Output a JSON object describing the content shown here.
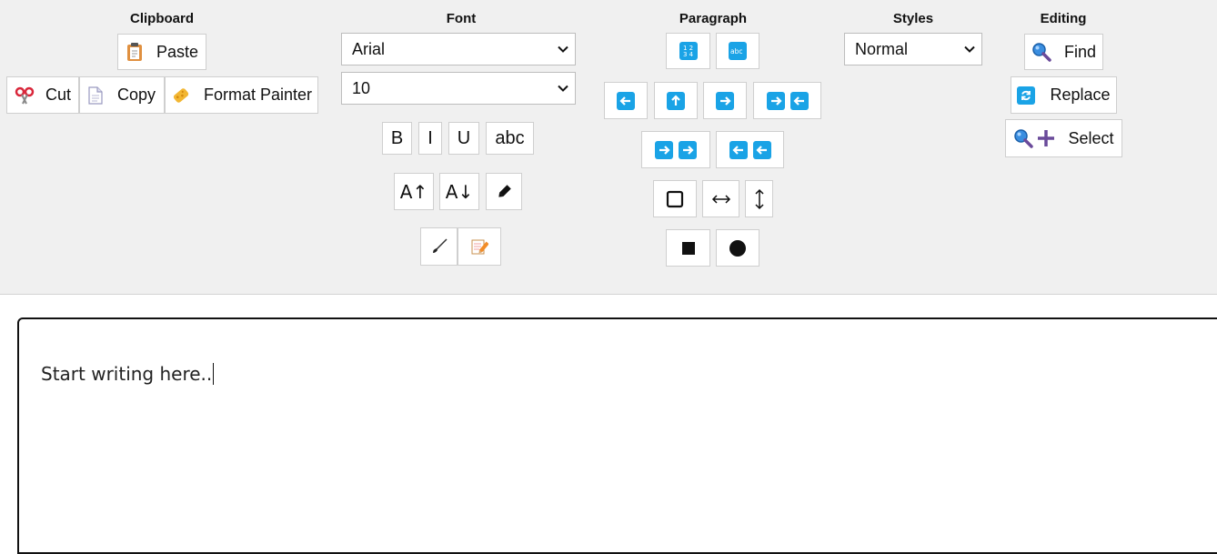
{
  "groups": {
    "clipboard": {
      "title": "Clipboard",
      "paste": "Paste",
      "cut": "Cut",
      "copy": "Copy",
      "format_painter": "Format Painter"
    },
    "font": {
      "title": "Font",
      "family": "Arial",
      "size": "10",
      "bold": "B",
      "italic": "I",
      "underline": "U",
      "strike": "abc",
      "grow": "A↑",
      "shrink": "A↓"
    },
    "paragraph": {
      "title": "Paragraph"
    },
    "styles": {
      "title": "Styles",
      "value": "Normal"
    },
    "editing": {
      "title": "Editing",
      "find": "Find",
      "replace": "Replace",
      "select": "Select"
    }
  },
  "editor": {
    "text": "Start writing here.."
  },
  "colors": {
    "ribbon_bg": "#f0f0f0",
    "accent_blue": "#1aa3e6"
  }
}
